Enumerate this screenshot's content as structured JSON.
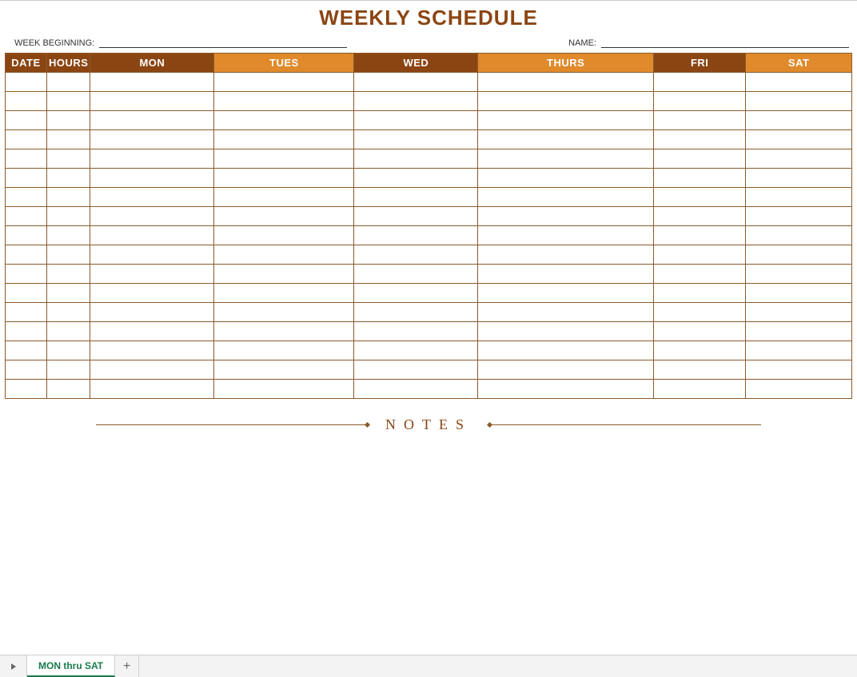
{
  "title": "WEEKLY SCHEDULE",
  "meta": {
    "week_beginning_label": "WEEK BEGINNING:",
    "week_beginning_value": "",
    "name_label": "NAME:",
    "name_value": ""
  },
  "columns": {
    "date": "DATE",
    "hours": "HOURS",
    "mon": "MON",
    "tues": "TUES",
    "wed": "WED",
    "thurs": "THURS",
    "fri": "FRI",
    "sat": "SAT"
  },
  "row_count": 17,
  "notes_label": "NOTES",
  "tab": {
    "active": "MON thru SAT"
  }
}
